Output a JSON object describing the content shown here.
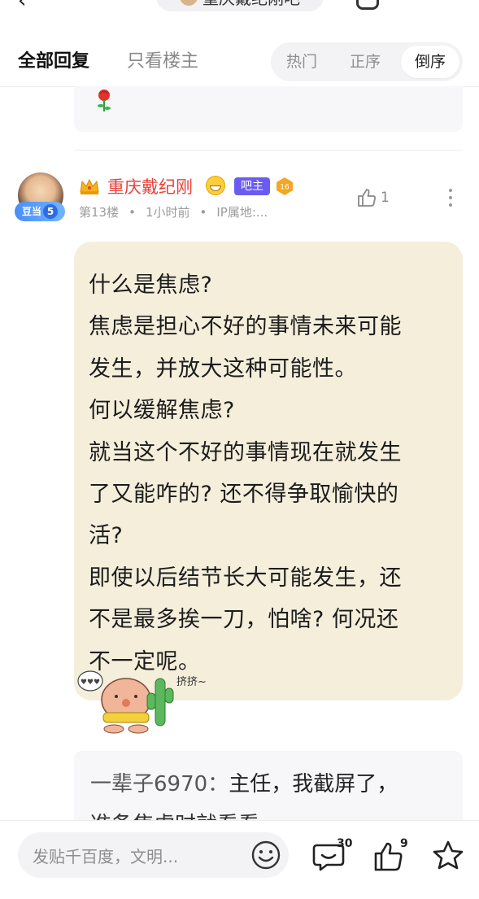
{
  "topbar": {
    "forum_title": "重庆戴纪刚吧"
  },
  "filter": {
    "tabs": [
      "全部回复",
      "只看楼主"
    ],
    "sort_options": [
      "热门",
      "正序",
      "倒序"
    ],
    "active_sort": "倒序"
  },
  "post": {
    "username": "重庆戴纪刚",
    "role_badge": "吧主",
    "grade": "16",
    "level": "5",
    "level_label": "豆当",
    "floor": "第13楼",
    "time": "1小时前",
    "location": "IP属地:...",
    "likes": "1",
    "content_lines": [
      "什么是焦虑?",
      "焦虑是担心不好的事情未来可能",
      "发生，并放大这种可能性。",
      "何以缓解焦虑?",
      "就当这个不好的事情现在就发生",
      "了又能咋的? 还不得争取愉快的",
      "活?",
      "即使以后结节长大可能发生，还",
      "不是最多挨一刀，怕啥? 何况还",
      "不一定呢。"
    ],
    "sticker_text": "挤挤~"
  },
  "sub_reply": {
    "author": "一辈子6970",
    "text": "主任，我截屏了，",
    "text_line2": "准备焦虑时就看看"
  },
  "bottombar": {
    "placeholder": "发贴千百度，文明...",
    "reply_count": "30",
    "like_count": "9"
  },
  "colors": {
    "username": "#e8423a",
    "role_badge": "#6a5cf0",
    "content_bg": "#f4eedb",
    "accent_grade": "#f5a623"
  }
}
